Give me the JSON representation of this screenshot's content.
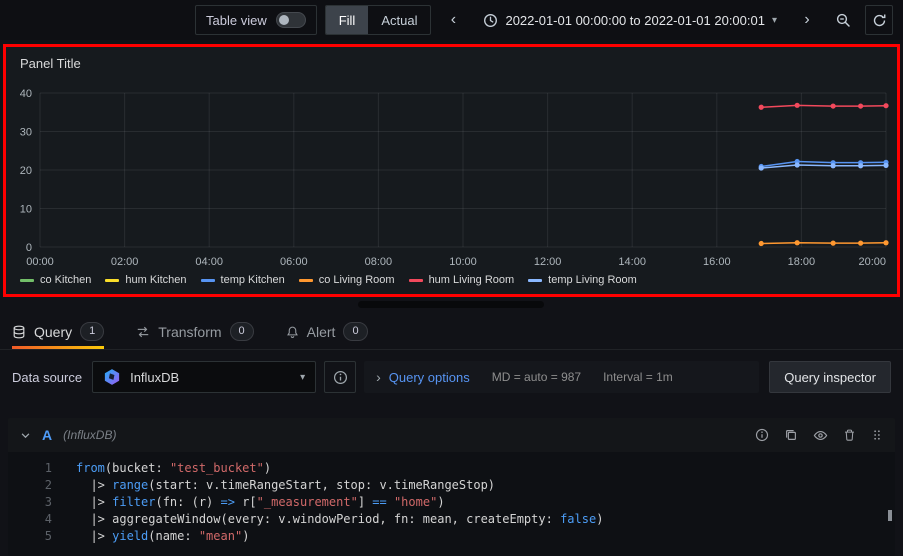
{
  "toolbar": {
    "table_view_label": "Table view",
    "fill_label": "Fill",
    "actual_label": "Actual",
    "time_range": "2022-01-01 00:00:00 to 2022-01-01 20:00:01"
  },
  "icons": {
    "chevron_left": "‹",
    "chevron_right": "›",
    "caret_down": "▾",
    "options_chevron": "›"
  },
  "panel": {
    "title": "Panel Title"
  },
  "chart_data": {
    "type": "line",
    "title": "Panel Title",
    "x_tick_hours": [
      0,
      2,
      4,
      6,
      8,
      10,
      12,
      14,
      16,
      18,
      20
    ],
    "x_tick_labels": [
      "00:00",
      "02:00",
      "04:00",
      "06:00",
      "08:00",
      "10:00",
      "12:00",
      "14:00",
      "16:00",
      "18:00",
      "20:00"
    ],
    "xlim_hours": [
      0,
      20
    ],
    "y_ticks": [
      0,
      10,
      20,
      30,
      40
    ],
    "ylim": [
      0,
      40
    ],
    "grid": true,
    "legend_position": "bottom",
    "series": [
      {
        "name": "co Kitchen",
        "color": "#73bf69",
        "x": [],
        "y": []
      },
      {
        "name": "hum Kitchen",
        "color": "#fade2a",
        "x": [],
        "y": []
      },
      {
        "name": "temp Kitchen",
        "color": "#5794f2",
        "x": [
          17.05,
          17.9,
          18.75,
          19.4,
          20
        ],
        "y": [
          20.9,
          22.2,
          21.9,
          21.9,
          22.0
        ]
      },
      {
        "name": "co Living Room",
        "color": "#ff9830",
        "x": [
          17.05,
          17.9,
          18.75,
          19.4,
          20
        ],
        "y": [
          0.9,
          1.1,
          1.0,
          1.0,
          1.1
        ]
      },
      {
        "name": "hum Living Room",
        "color": "#f2495c",
        "x": [
          17.05,
          17.9,
          18.75,
          19.4,
          20
        ],
        "y": [
          36.3,
          36.8,
          36.6,
          36.6,
          36.7
        ]
      },
      {
        "name": "temp Living Room",
        "color": "#8ab8ff",
        "x": [
          17.05,
          17.9,
          18.75,
          19.4,
          20
        ],
        "y": [
          20.5,
          21.3,
          21.1,
          21.1,
          21.2
        ]
      }
    ]
  },
  "tabs": [
    {
      "label": "Query",
      "count": "1"
    },
    {
      "label": "Transform",
      "count": "0"
    },
    {
      "label": "Alert",
      "count": "0"
    }
  ],
  "query_row": {
    "datasource_label": "Data source",
    "datasource_value": "InfluxDB",
    "query_options_label": "Query options",
    "md_text": "MD = auto = 987",
    "interval_text": "Interval = 1m",
    "inspector_button": "Query inspector"
  },
  "query_editor": {
    "ref_id": "A",
    "datasource_hint": "(InfluxDB)",
    "code": [
      [
        [
          "from",
          "kw"
        ],
        [
          "(bucket: ",
          "def"
        ],
        [
          "\"test_bucket\"",
          "str"
        ],
        [
          ")",
          "def"
        ]
      ],
      [
        [
          "  |> ",
          "def"
        ],
        [
          "range",
          "kw"
        ],
        [
          "(start: v.timeRangeStart, stop: v.timeRangeStop)",
          "def"
        ]
      ],
      [
        [
          "  |> ",
          "def"
        ],
        [
          "filter",
          "kw"
        ],
        [
          "(fn: (r) ",
          "def"
        ],
        [
          "=>",
          "kw"
        ],
        [
          " r[",
          "def"
        ],
        [
          "\"_measurement\"",
          "str"
        ],
        [
          "] ",
          "def"
        ],
        [
          "==",
          "kw"
        ],
        [
          " ",
          "def"
        ],
        [
          "\"home\"",
          "str"
        ],
        [
          ")",
          "def"
        ]
      ],
      [
        [
          "  |> aggregateWindow(every: v.windowPeriod, fn: mean, createEmpty: ",
          "def"
        ],
        [
          "false",
          "kw"
        ],
        [
          ")",
          "def"
        ]
      ],
      [
        [
          "  |> ",
          "def"
        ],
        [
          "yield",
          "kw"
        ],
        [
          "(name: ",
          "def"
        ],
        [
          "\"mean\"",
          "str"
        ],
        [
          ")",
          "def"
        ]
      ]
    ]
  }
}
